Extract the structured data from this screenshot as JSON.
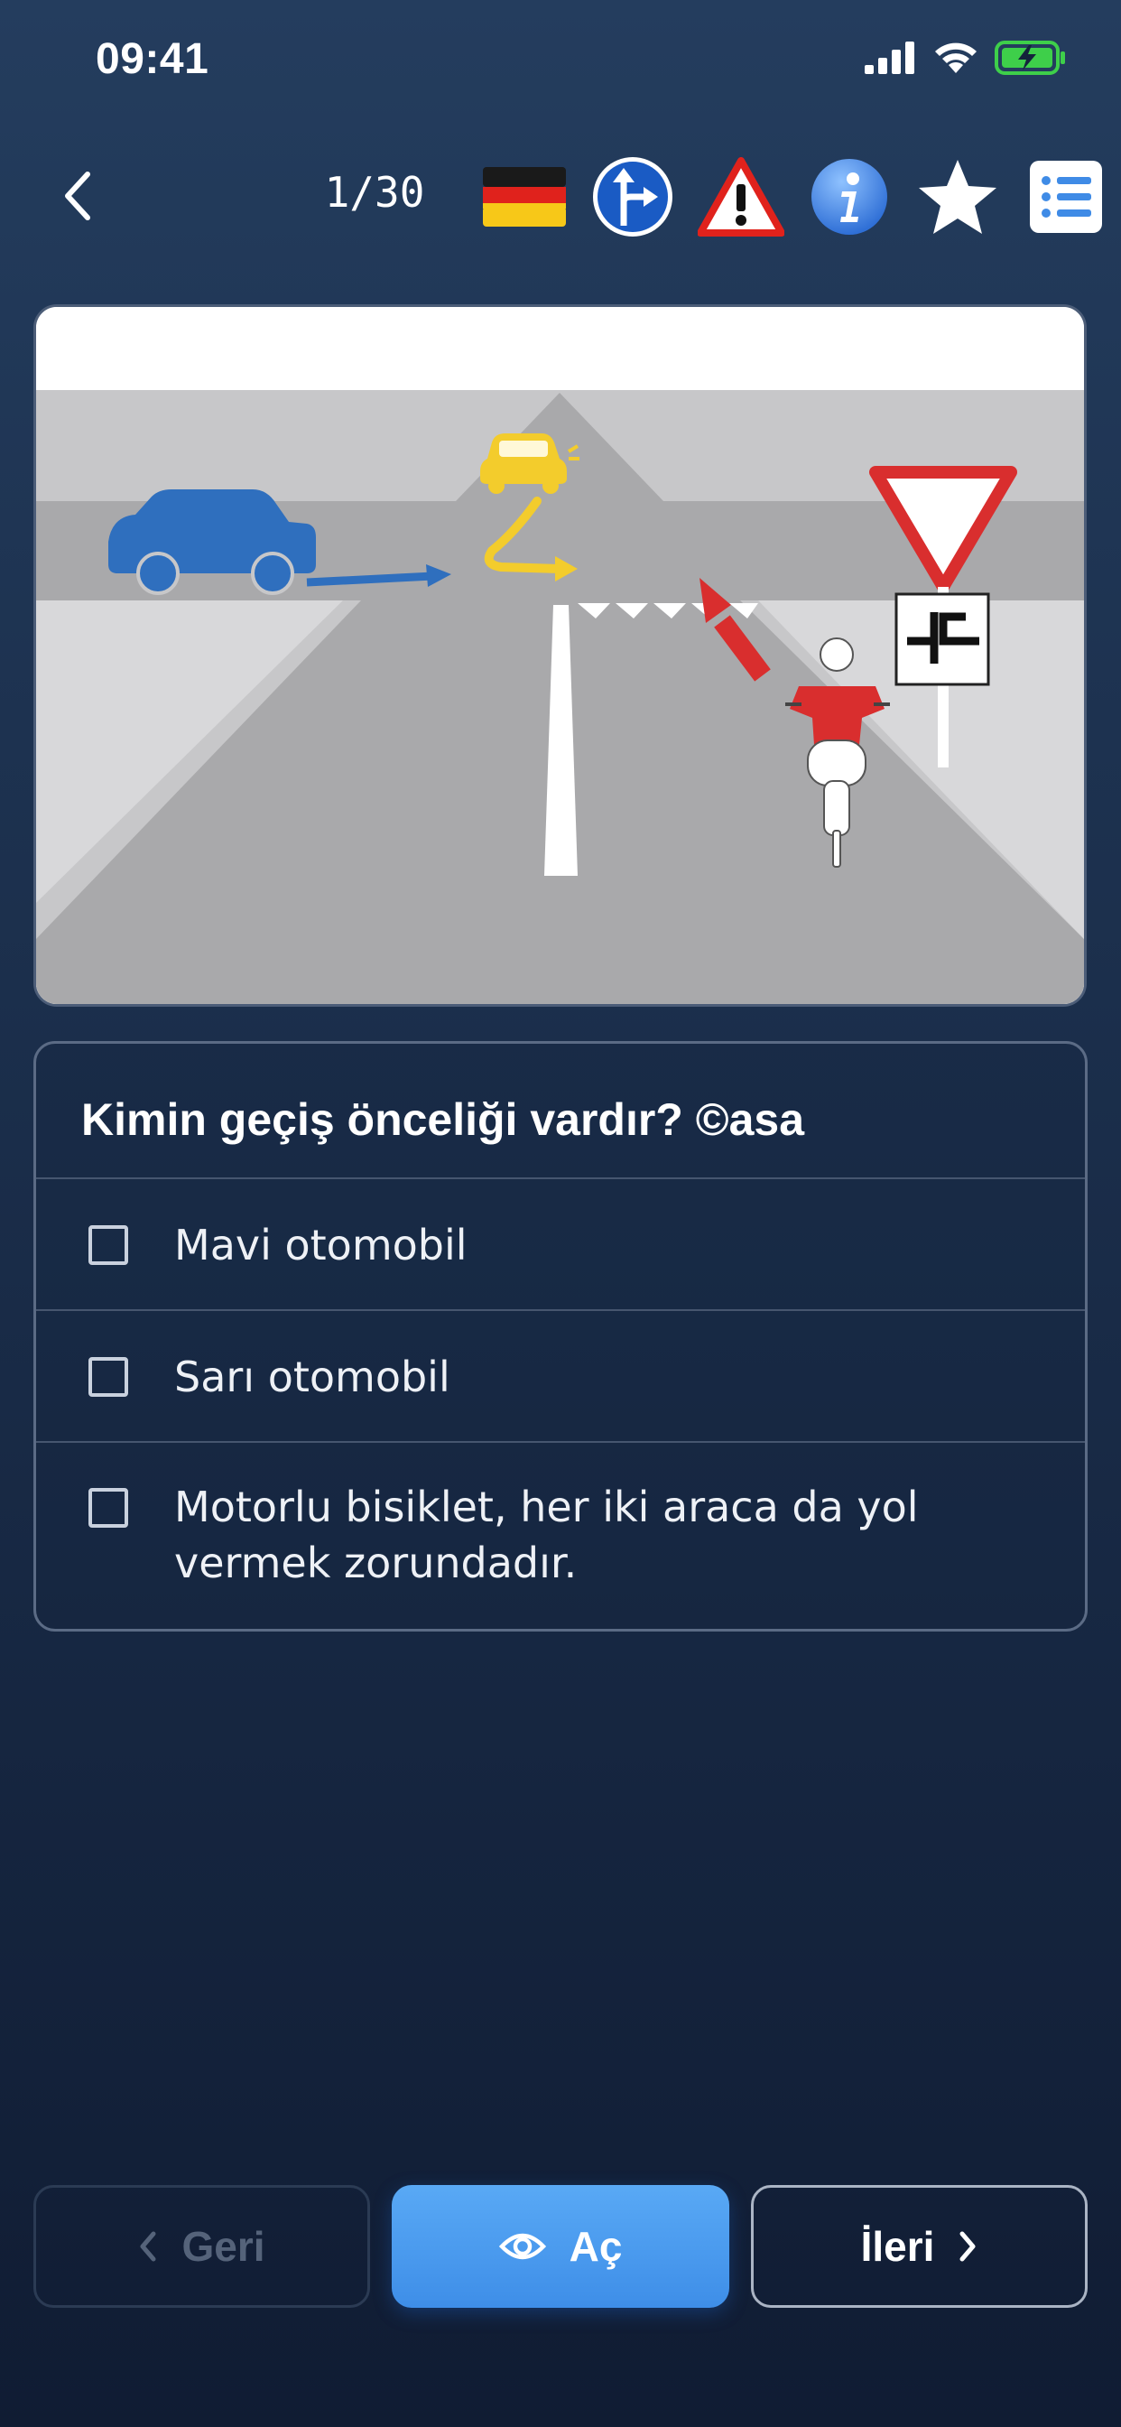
{
  "status_bar": {
    "time": "09:41",
    "icons": [
      "signal-icon",
      "wifi-icon",
      "battery-charging-icon"
    ],
    "battery_color": "#3ecf4a"
  },
  "toolbar": {
    "back_icon": "chevron-left-icon",
    "counter": "1/30",
    "icons": [
      "germany-flag-icon",
      "direction-arrow-sign-icon",
      "warning-triangle-icon",
      "info-icon",
      "star-icon",
      "list-icon"
    ]
  },
  "question": {
    "title": "Kimin geçiş önceliği vardır? ©asa",
    "answers": [
      {
        "text": "Mavi otomobil",
        "checked": false
      },
      {
        "text": "Sarı otomobil",
        "checked": false
      },
      {
        "text": "Motorlu bisiklet, her iki araca da yol vermek zorundadır.",
        "checked": false
      }
    ]
  },
  "navigation": {
    "prev_label": "Geri",
    "reveal_label": "Aç",
    "next_label": "İleri",
    "prev_enabled": false
  },
  "colors": {
    "accent": "#4a9bee",
    "background_top": "#243d5e",
    "background_bottom": "#101c33"
  }
}
